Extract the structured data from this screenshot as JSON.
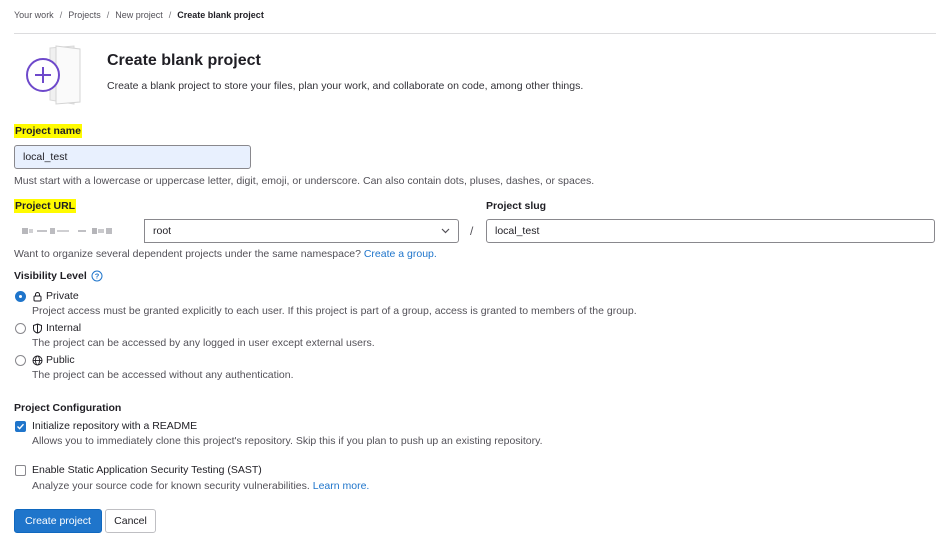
{
  "breadcrumb": [
    {
      "label": "Your work"
    },
    {
      "label": "Projects"
    },
    {
      "label": "New project"
    },
    {
      "label": "Create blank project"
    }
  ],
  "header": {
    "title": "Create blank project",
    "subtitle": "Create a blank project to store your files, plan your work, and collaborate on code, among other things."
  },
  "project_name": {
    "label": "Project name",
    "value": "local_test",
    "help": "Must start with a lowercase or uppercase letter, digit, emoji, or underscore. Can also contain dots, pluses, dashes, or spaces."
  },
  "project_url": {
    "label": "Project URL",
    "namespace": "root",
    "separator": "/"
  },
  "project_slug": {
    "label": "Project slug",
    "value": "local_test"
  },
  "group_hint": {
    "text": "Want to organize several dependent projects under the same namespace?",
    "link": "Create a group."
  },
  "visibility": {
    "label": "Visibility Level",
    "options": [
      {
        "title": "Private",
        "desc": "Project access must be granted explicitly to each user. If this project is part of a group, access is granted to members of the group.",
        "checked": true
      },
      {
        "title": "Internal",
        "desc": "The project can be accessed by any logged in user except external users.",
        "checked": false
      },
      {
        "title": "Public",
        "desc": "The project can be accessed without any authentication.",
        "checked": false
      }
    ]
  },
  "configuration": {
    "label": "Project Configuration",
    "readme": {
      "title": "Initialize repository with a README",
      "desc": "Allows you to immediately clone this project's repository. Skip this if you plan to push up an existing repository.",
      "checked": true
    },
    "sast": {
      "title": "Enable Static Application Security Testing (SAST)",
      "desc": "Analyze your source code for known security vulnerabilities.",
      "link": "Learn more.",
      "checked": false
    }
  },
  "actions": {
    "create": "Create project",
    "cancel": "Cancel"
  },
  "colors": {
    "accent": "#1f75cb",
    "highlight": "#fffb00",
    "autofill": "#e8f0fe"
  }
}
